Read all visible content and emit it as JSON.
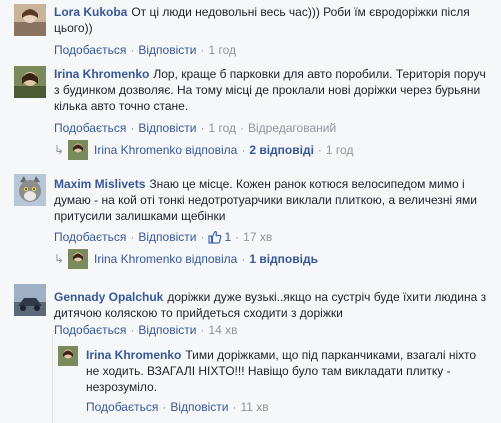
{
  "comments": [
    {
      "author": "Lora Kukoba",
      "text": "От ці люди недовольні весь час))) Роби їм євродоріжки після цього))",
      "like": "Подобається",
      "reply": "Відповісти",
      "time": "1 год"
    },
    {
      "author": "Irina Khromenko",
      "text": "Лор, краще б парковки для авто поробили. Територія поруч з будинком дозволяє. На тому місці де проклали нові доріжки через бурьяни кілька авто точно стане.",
      "like": "Подобається",
      "reply": "Відповісти",
      "time": "1 год",
      "edited": "Відредагований",
      "replies_name": "Irina Khromenko",
      "replies_verb": "відповіла",
      "replies_count": "2 відповіді",
      "replies_time": "1 год"
    },
    {
      "author": "Maxim Mislivets",
      "text": "Знаю це місце. Кожен ранок котюся велосипедом мимо і думаю - на кой оті тонкі недотротуарчики виклали плиткою, а величезні ями притусили залишками щебінки",
      "like": "Подобається",
      "reply": "Відповісти",
      "likes_count": "1",
      "time": "17 хв",
      "replies_name": "Irina Khromenko",
      "replies_verb": "відповіла",
      "replies_count": "1 відповідь"
    },
    {
      "author": "Gennady Opalchuk",
      "text": "доріжки дуже вузькі..якщо на сустріч буде їхити людина з дитячою коляскою то прийдеться сходити з доріжки",
      "like": "Подобається",
      "reply": "Відповісти",
      "time": "14 хв"
    }
  ],
  "nested_reply": {
    "author": "Irina Khromenko",
    "text": "Тими доріжками, що під парканчиками, взагалі ніхто не ходить. ВЗАГАЛІ НІХТО!!! Навіщо було там викладати плитку - незрозуміло.",
    "like": "Подобається",
    "reply": "Відповісти",
    "time": "11 хв"
  }
}
